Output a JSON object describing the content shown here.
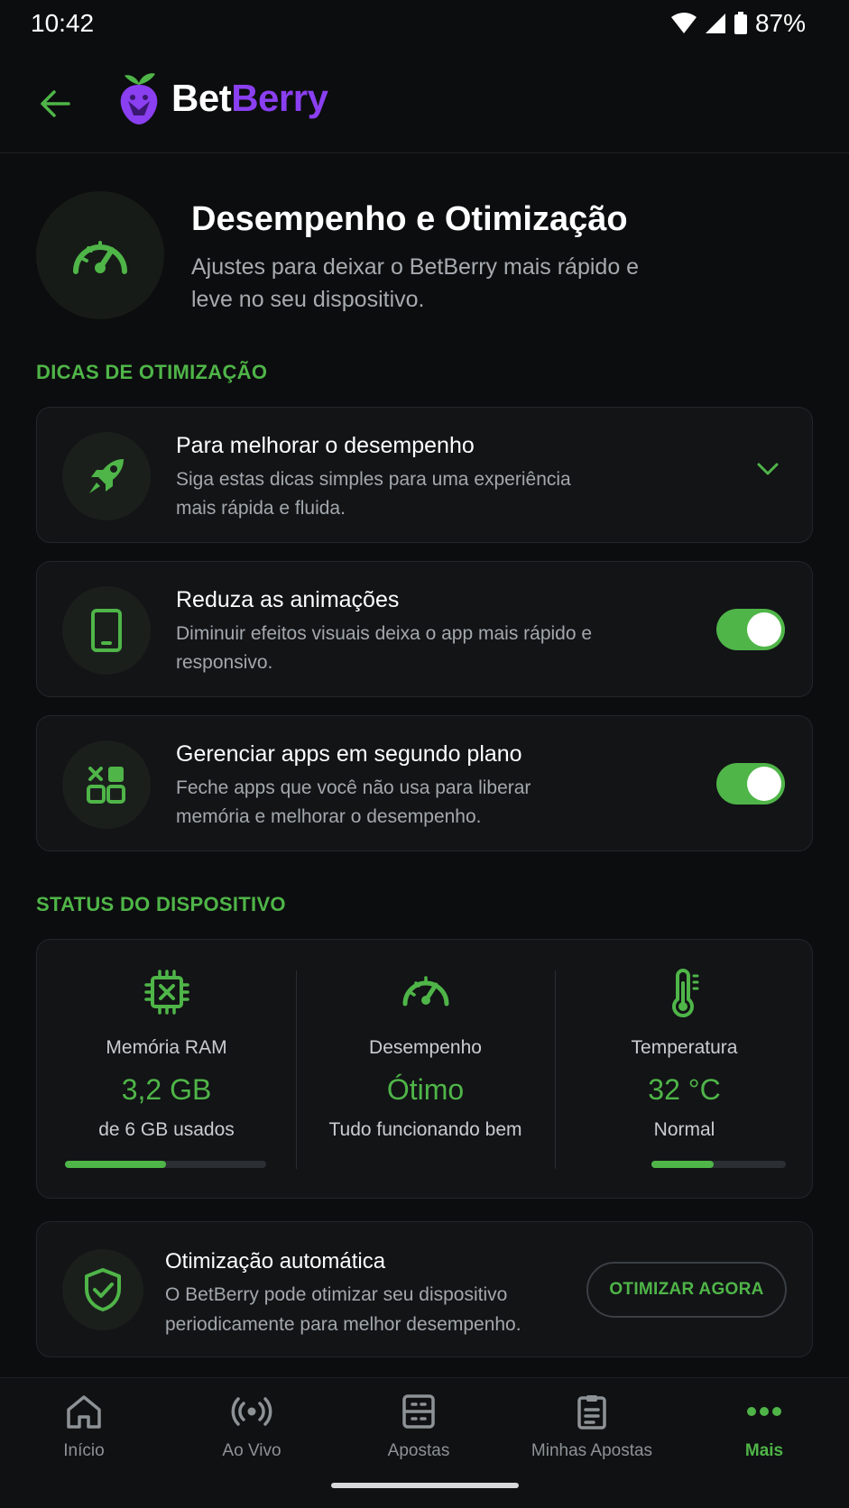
{
  "status_bar": {
    "time": "10:42",
    "battery": "87%"
  },
  "app_bar": {
    "brand_part1": "Bet",
    "brand_part2": "Berry"
  },
  "hero": {
    "title": "Desempenho e Otimização",
    "subtitle": "Ajustes para deixar o BetBerry mais rápido e leve no seu dispositivo."
  },
  "tips_section": {
    "label": "DICAS DE OTIMIZAÇÃO",
    "items": [
      {
        "title": "Para melhorar o desempenho",
        "desc": "Siga estas dicas simples para uma experiência mais rápida e fluida.",
        "icon": "rocket-icon"
      },
      {
        "title": "Reduza as animações",
        "desc": "Diminuir efeitos visuais deixa o app mais rápido e responsivo.",
        "icon": "phone-icon",
        "toggle_on": true
      },
      {
        "title": "Gerenciar apps em segundo plano",
        "desc": "Feche apps que você não usa para liberar memória e melhorar o desempenho.",
        "icon": "apps-icon",
        "toggle_on": true
      }
    ]
  },
  "status_section": {
    "label": "STATUS DO DISPOSITIVO",
    "stats": [
      {
        "label": "Memória RAM",
        "value": "3,2 GB",
        "sub": "de 6 GB usados",
        "progress": 0.5,
        "icon": "chip-icon"
      },
      {
        "label": "Desempenho",
        "value": "Ótimo",
        "sub": "Tudo funcionando bem",
        "icon": "speedometer-icon"
      },
      {
        "label": "Temperatura",
        "value": "32 °C",
        "sub": "Normal",
        "progress": 0.46,
        "icon": "thermometer-icon"
      }
    ]
  },
  "auto_opt": {
    "title": "Otimização automática",
    "desc": "O BetBerry pode otimizar seu dispositivo periodicamente para melhor desempenho.",
    "button": "OTIMIZAR AGORA"
  },
  "nav": {
    "items": [
      {
        "label": "Início",
        "icon": "home-icon"
      },
      {
        "label": "Ao Vivo",
        "icon": "live-icon"
      },
      {
        "label": "Apostas",
        "icon": "bets-icon"
      },
      {
        "label": "Minhas Apostas",
        "icon": "clipboard-icon"
      },
      {
        "label": "Mais",
        "icon": "more-icon",
        "active": true
      }
    ]
  },
  "colors": {
    "accent": "#4fb548",
    "brand_purple": "#8a3ff0",
    "background": "#0c0d0e",
    "card": "#121416"
  }
}
